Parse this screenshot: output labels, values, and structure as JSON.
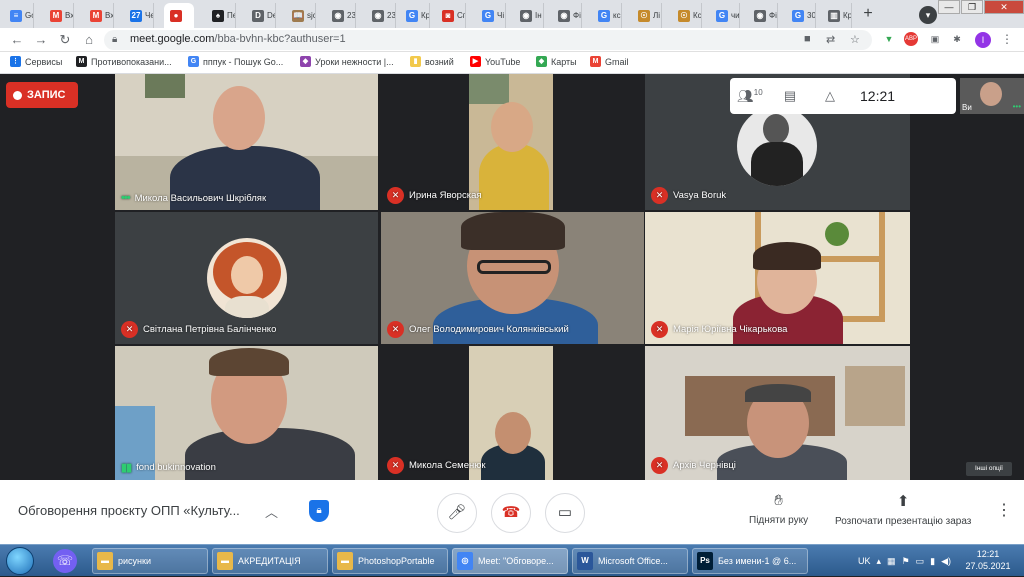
{
  "tabs": [
    {
      "label": "Go",
      "icon": "docs-icon",
      "color": "#4285f4",
      "glyph": "≡"
    },
    {
      "label": "Вх",
      "icon": "gmail-icon",
      "color": "#ea4335",
      "glyph": "M"
    },
    {
      "label": "Вх",
      "icon": "gmail-icon",
      "color": "#ea4335",
      "glyph": "M"
    },
    {
      "label": "Че",
      "icon": "calendar-icon",
      "color": "#1a73e8",
      "glyph": "27"
    },
    {
      "label": "",
      "icon": "recording-icon",
      "color": "#d93025",
      "glyph": "●"
    },
    {
      "label": "Пе",
      "icon": "spade-icon",
      "color": "#202124",
      "glyph": "♠"
    },
    {
      "label": "De",
      "icon": "d-icon",
      "color": "#5f6368",
      "glyph": "D"
    },
    {
      "label": "sjc",
      "icon": "book-icon",
      "color": "#9e7b4f",
      "glyph": "📖"
    },
    {
      "label": "23",
      "icon": "globe-icon",
      "color": "#5f6368",
      "glyph": "◉"
    },
    {
      "label": "23",
      "icon": "globe-icon",
      "color": "#5f6368",
      "glyph": "◉"
    },
    {
      "label": "Кр",
      "icon": "google-icon",
      "color": "#4285f4",
      "glyph": "G"
    },
    {
      "label": "Сп",
      "icon": "red-square-icon",
      "color": "#d93025",
      "glyph": "◙"
    },
    {
      "label": "Чі",
      "icon": "google-icon",
      "color": "#4285f4",
      "glyph": "G"
    },
    {
      "label": "Ін",
      "icon": "globe-icon",
      "color": "#5f6368",
      "glyph": "◉"
    },
    {
      "label": "Фі",
      "icon": "globe-icon",
      "color": "#5f6368",
      "glyph": "◉"
    },
    {
      "label": "кс",
      "icon": "google-icon",
      "color": "#4285f4",
      "glyph": "G"
    },
    {
      "label": "Лі",
      "icon": "owl-icon",
      "color": "#c58a2b",
      "glyph": "☉"
    },
    {
      "label": "Кс",
      "icon": "owl-icon",
      "color": "#c58a2b",
      "glyph": "☉"
    },
    {
      "label": "чи",
      "icon": "google-icon",
      "color": "#4285f4",
      "glyph": "G"
    },
    {
      "label": "Фі",
      "icon": "globe-icon",
      "color": "#5f6368",
      "glyph": "◉"
    },
    {
      "label": "30",
      "icon": "google-icon",
      "color": "#4285f4",
      "glyph": "G"
    },
    {
      "label": "Кр",
      "icon": "bars-icon",
      "color": "#5f6368",
      "glyph": "▥"
    }
  ],
  "window_controls": {
    "minimize": "—",
    "restore": "❐",
    "close": "✕"
  },
  "address": {
    "url_host": "meet.google.com",
    "url_path": "/bba-bvhn-kbc?authuser=1"
  },
  "bookmarks": [
    {
      "label": "Сервисы",
      "icon": "apps-icon",
      "color": "#1a73e8",
      "glyph": "⋮"
    },
    {
      "label": "Противопоказани...",
      "icon": "bookmark-icon",
      "color": "#202124",
      "glyph": "M"
    },
    {
      "label": "пппук - Пошук Go...",
      "icon": "google-icon",
      "color": "#4285f4",
      "glyph": "G"
    },
    {
      "label": "Уроки нежности |...",
      "icon": "diamond-icon",
      "color": "#8e44ad",
      "glyph": "◆"
    },
    {
      "label": "возний",
      "icon": "folder-icon",
      "color": "#f2c94c",
      "glyph": "▮"
    },
    {
      "label": "YouTube",
      "icon": "youtube-icon",
      "color": "#ff0000",
      "glyph": "▶"
    },
    {
      "label": "Карты",
      "icon": "maps-icon",
      "color": "#34a853",
      "glyph": "◆"
    },
    {
      "label": "Gmail",
      "icon": "gmail-icon",
      "color": "#ea4335",
      "glyph": "M"
    }
  ],
  "meet": {
    "record_label": "ЗАПИС",
    "participants_count": "10",
    "time": "12:21",
    "self_name": "Ви",
    "more_options_tooltip": "Інші опції",
    "participants": [
      {
        "name": "Микола Васильович Шкрібляк",
        "status": "speaking"
      },
      {
        "name": "Ирина Яворская",
        "status": "muted"
      },
      {
        "name": "Vasya Boruk",
        "status": "muted"
      },
      {
        "name": "Світлана Петрівна Балінченко",
        "status": "muted"
      },
      {
        "name": "Олег Володимирович Колянківський",
        "status": "muted"
      },
      {
        "name": "Марія Юріївна Чікарькова",
        "status": "muted"
      },
      {
        "name": "fond bukinnovation",
        "status": "speaking"
      },
      {
        "name": "Микола Семенюк",
        "status": "muted"
      },
      {
        "name": "Архів Чернівці",
        "status": "muted"
      }
    ]
  },
  "bottom": {
    "meeting_title": "Обговорення проєкту ОПП «Культу...",
    "raise_hand": "Підняти руку",
    "present_now": "Розпочати презентацію зараз"
  },
  "taskbar": {
    "items": [
      {
        "label": "рисунки",
        "icon": "folder-icon",
        "color": "#e8b84a"
      },
      {
        "label": "АКРЕДИТАЦІЯ",
        "icon": "folder-icon",
        "color": "#e8b84a"
      },
      {
        "label": "PhotoshopPortable",
        "icon": "folder-icon",
        "color": "#e8b84a"
      },
      {
        "label": "Meet: \"Обговоре...",
        "icon": "chrome-icon",
        "color": "#4285f4"
      },
      {
        "label": "Microsoft Office...",
        "icon": "word-icon",
        "color": "#2b579a"
      },
      {
        "label": "Без имени-1 @ 6...",
        "icon": "photoshop-icon",
        "color": "#001e36"
      }
    ],
    "lang": "UK",
    "clock_time": "12:21",
    "clock_date": "27.05.2021"
  }
}
